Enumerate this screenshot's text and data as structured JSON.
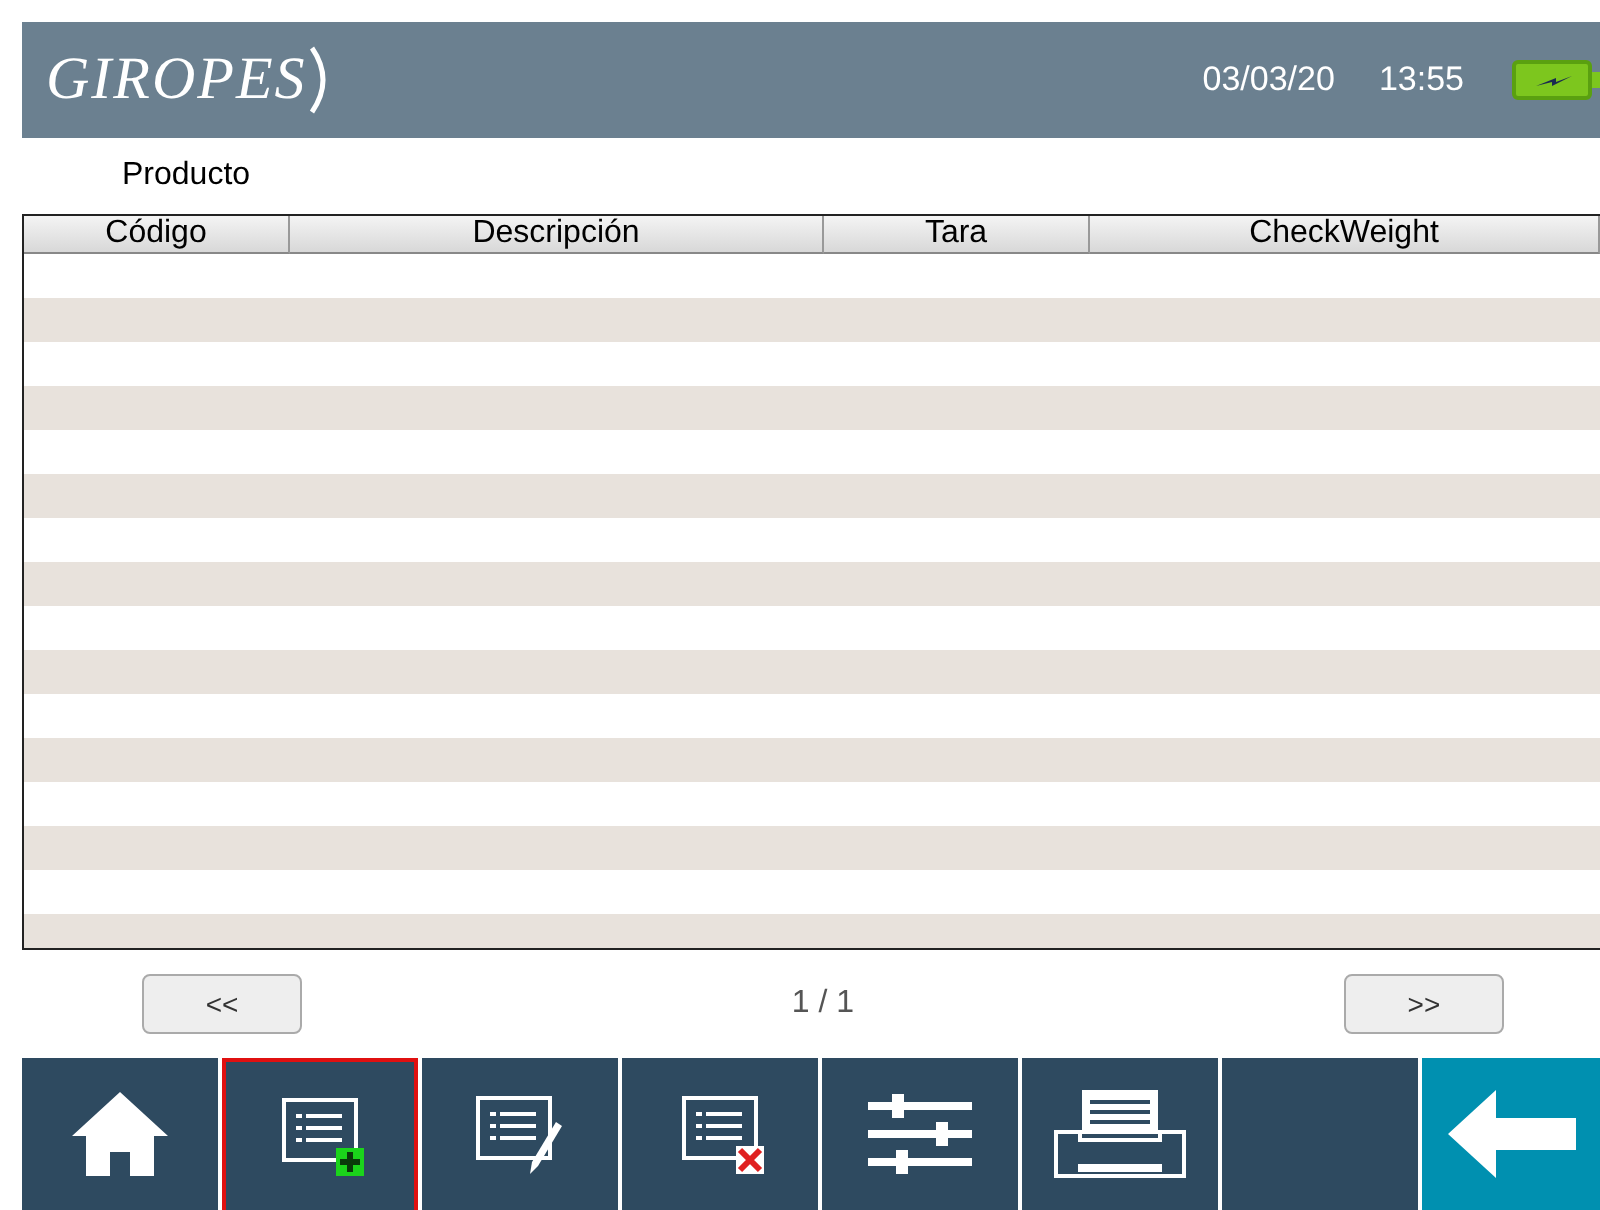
{
  "header": {
    "logo": "GIROPES",
    "date": "03/03/20",
    "time": "13:55"
  },
  "title": "Producto",
  "table": {
    "columns": [
      "Código",
      "Descripción",
      "Tara",
      "CheckWeight"
    ]
  },
  "pager": {
    "prev": "<<",
    "page": "1 / 1",
    "next": ">>"
  },
  "toolbar": [
    {
      "kind": "home",
      "selected": false
    },
    {
      "kind": "add",
      "selected": true
    },
    {
      "kind": "edit",
      "selected": false
    },
    {
      "kind": "delete",
      "selected": false
    },
    {
      "kind": "settings",
      "selected": false
    },
    {
      "kind": "print",
      "selected": false
    },
    {
      "kind": "empty",
      "selected": false
    },
    {
      "kind": "back",
      "selected": false
    }
  ]
}
